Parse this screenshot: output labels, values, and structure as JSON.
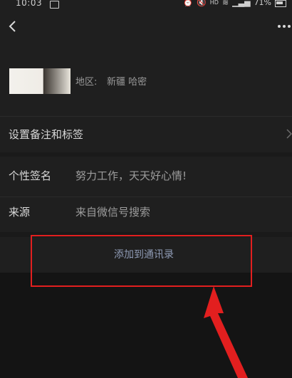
{
  "status_bar": {
    "time": "10:03",
    "network": "HD",
    "battery": "71%"
  },
  "profile": {
    "region_label": "地区:",
    "region_value": "新疆  哈密"
  },
  "remark": {
    "label": "设置备注和标签"
  },
  "info": {
    "signature_label": "个性签名",
    "signature_value": "努力工作，天天好心情!",
    "source_label": "来源",
    "source_value": "来自微信号搜索"
  },
  "actions": {
    "add_to_contacts": "添加到通讯录"
  },
  "colors": {
    "background": "#1a1a1a",
    "panel": "#1f1f1f",
    "link": "#8f9bb5",
    "highlight": "#e21f1f"
  }
}
